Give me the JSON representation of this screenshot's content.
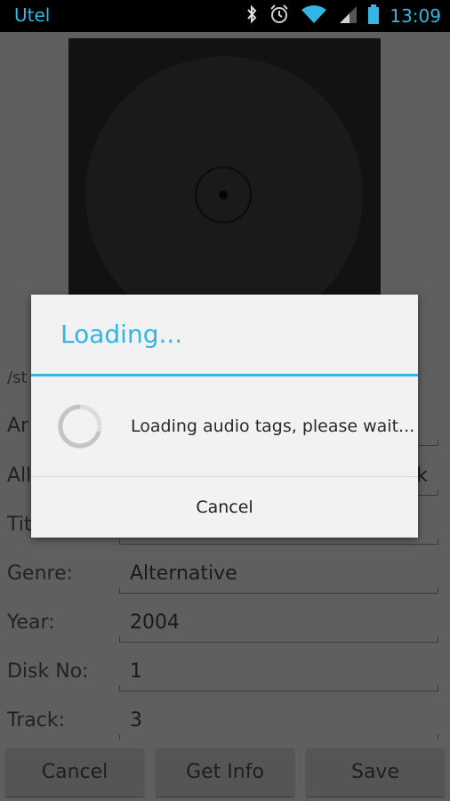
{
  "status_bar": {
    "carrier": "Utel",
    "time": "13:09",
    "icons": [
      "bluetooth-icon",
      "alarm-icon",
      "wifi-icon",
      "signal-icon",
      "battery-icon"
    ]
  },
  "screen": {
    "file_path": "/st",
    "fields": [
      {
        "label": "Ar",
        "value": ""
      },
      {
        "label": "All",
        "value": "k"
      },
      {
        "label": "Tit",
        "value": ""
      },
      {
        "label": "Genre:",
        "value": "Alternative"
      },
      {
        "label": "Year:",
        "value": "2004"
      },
      {
        "label": "Disk No:",
        "value": "1"
      },
      {
        "label": "Track:",
        "value": "3"
      }
    ],
    "buttons": {
      "cancel": "Cancel",
      "get_info": "Get Info",
      "save": "Save"
    }
  },
  "dialog": {
    "title": "Loading...",
    "message": "Loading audio tags, please wait...",
    "cancel_label": "Cancel"
  },
  "colors": {
    "accent": "#33b5e5",
    "dialog_background": "#f2f2f2",
    "status_bar_background": "#000000"
  }
}
